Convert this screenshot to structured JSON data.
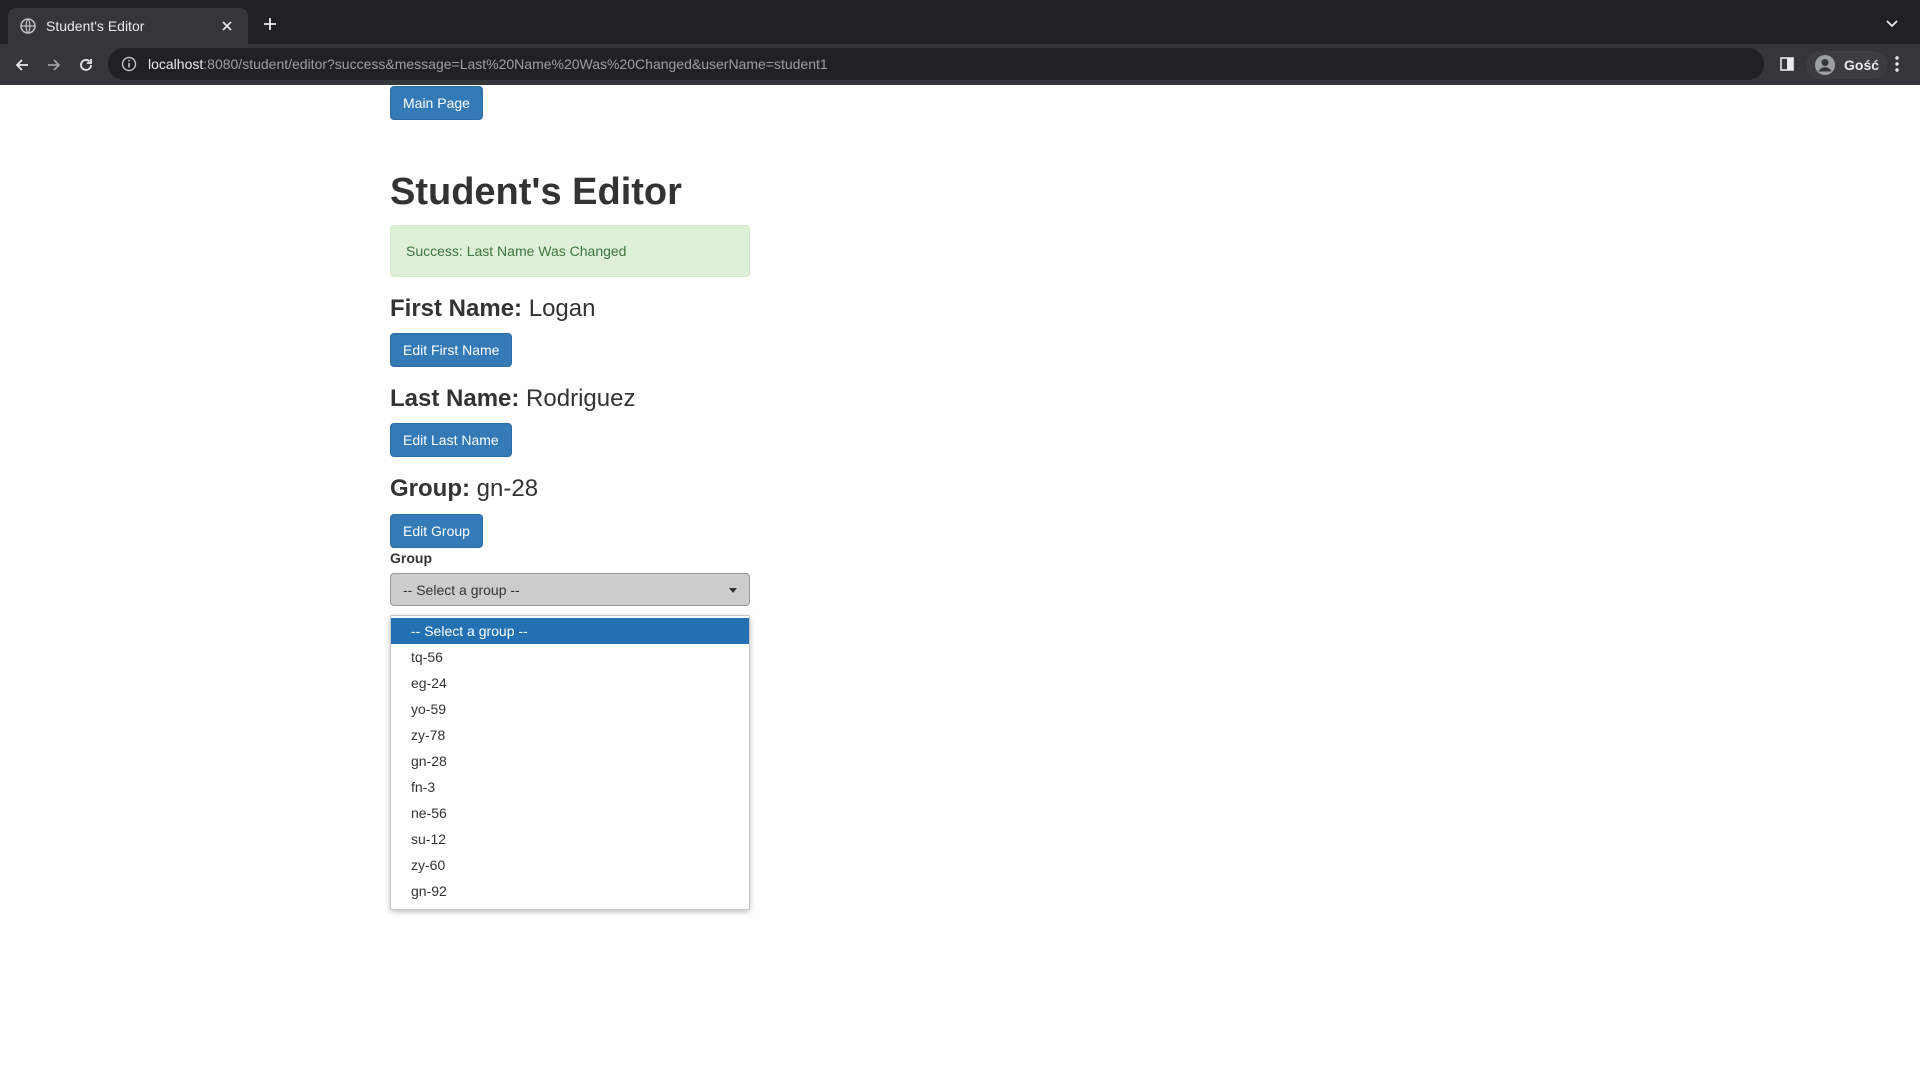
{
  "browser": {
    "tab_title": "Student's Editor",
    "url_host": "localhost",
    "url_rest": ":8080/student/editor?success&message=Last%20Name%20Was%20Changed&userName=student1",
    "profile_name": "Gość"
  },
  "page": {
    "main_page_button": "Main Page",
    "heading": "Student's Editor",
    "alert": "Success: Last Name Was Changed",
    "first_name_label": "First Name:",
    "first_name_value": "Logan",
    "edit_first_name": "Edit First Name",
    "last_name_label": "Last Name:",
    "last_name_value": "Rodriguez",
    "edit_last_name": "Edit Last Name",
    "group_title_label": "Group:",
    "group_title_value": "gn-28",
    "edit_group": "Edit Group",
    "group_field_label": "Group",
    "group_select_value": "-- Select a group --",
    "group_options": [
      "-- Select a group --",
      "tq-56",
      "eg-24",
      "yo-59",
      "zy-78",
      "gn-28",
      "fn-3",
      "ne-56",
      "su-12",
      "zy-60",
      "gn-92"
    ],
    "highlighted_option_index": 0
  },
  "colors": {
    "primary_button": "#337ab7",
    "alert_bg": "#dff0d8",
    "alert_text": "#3c763d",
    "highlighted_option": "#2371b3"
  }
}
